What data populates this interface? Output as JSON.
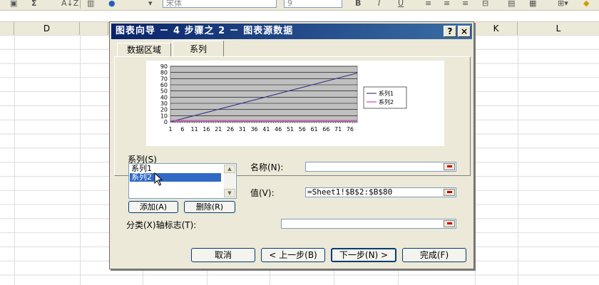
{
  "toolbar": {
    "sigma": "Σ",
    "sort": "A↓Z",
    "font_name": "宋体",
    "font_size": "9",
    "bold": "B",
    "italic": "I",
    "underline": "U"
  },
  "sheet": {
    "columns": [
      "D",
      "K",
      "L"
    ]
  },
  "dialog": {
    "title": "图表向导 － 4 步骤之 2 － 图表源数据",
    "help_label": "?",
    "close_label": "×",
    "tabs": [
      "数据区域",
      "系列"
    ],
    "active_tab": "系列",
    "series_label": "系列(S)",
    "series_items": [
      "系列1",
      "系列2"
    ],
    "selected_series": "系列2",
    "name_label": "名称(N):",
    "name_value": "",
    "value_label": "值(V):",
    "value_value": "=Sheet1!$B$2:$B$80",
    "add_button": "添加(A)",
    "remove_button": "删除(R)",
    "category_label": "分类(X)轴标志(T):",
    "category_value": "",
    "cancel_button": "取消",
    "back_button": "< 上一步(B)",
    "next_button": "下一步(N) >",
    "finish_button": "完成(F)"
  },
  "chart_data": {
    "type": "line",
    "x": [
      1,
      6,
      11,
      16,
      21,
      26,
      31,
      36,
      41,
      46,
      51,
      56,
      61,
      66,
      71,
      76
    ],
    "xtick_labels": [
      "1",
      "6",
      "11",
      "16",
      "21",
      "26",
      "31",
      "36",
      "41",
      "46",
      "51",
      "56",
      "61",
      "66",
      "71",
      "76"
    ],
    "ytick_labels": [
      "0",
      "10",
      "20",
      "30",
      "40",
      "50",
      "60",
      "70",
      "80",
      "90"
    ],
    "ylim": [
      0,
      90
    ],
    "xlim": [
      1,
      79
    ],
    "series": [
      {
        "name": "系列1",
        "color": "#3c3c8c",
        "x": [
          1,
          79
        ],
        "values": [
          0,
          79
        ]
      },
      {
        "name": "系列2",
        "color": "#e040c0",
        "x": [
          1,
          79
        ],
        "values": [
          2,
          2
        ]
      }
    ],
    "grid": true,
    "legend": "right",
    "plot_bg": "#c0c0c0"
  }
}
